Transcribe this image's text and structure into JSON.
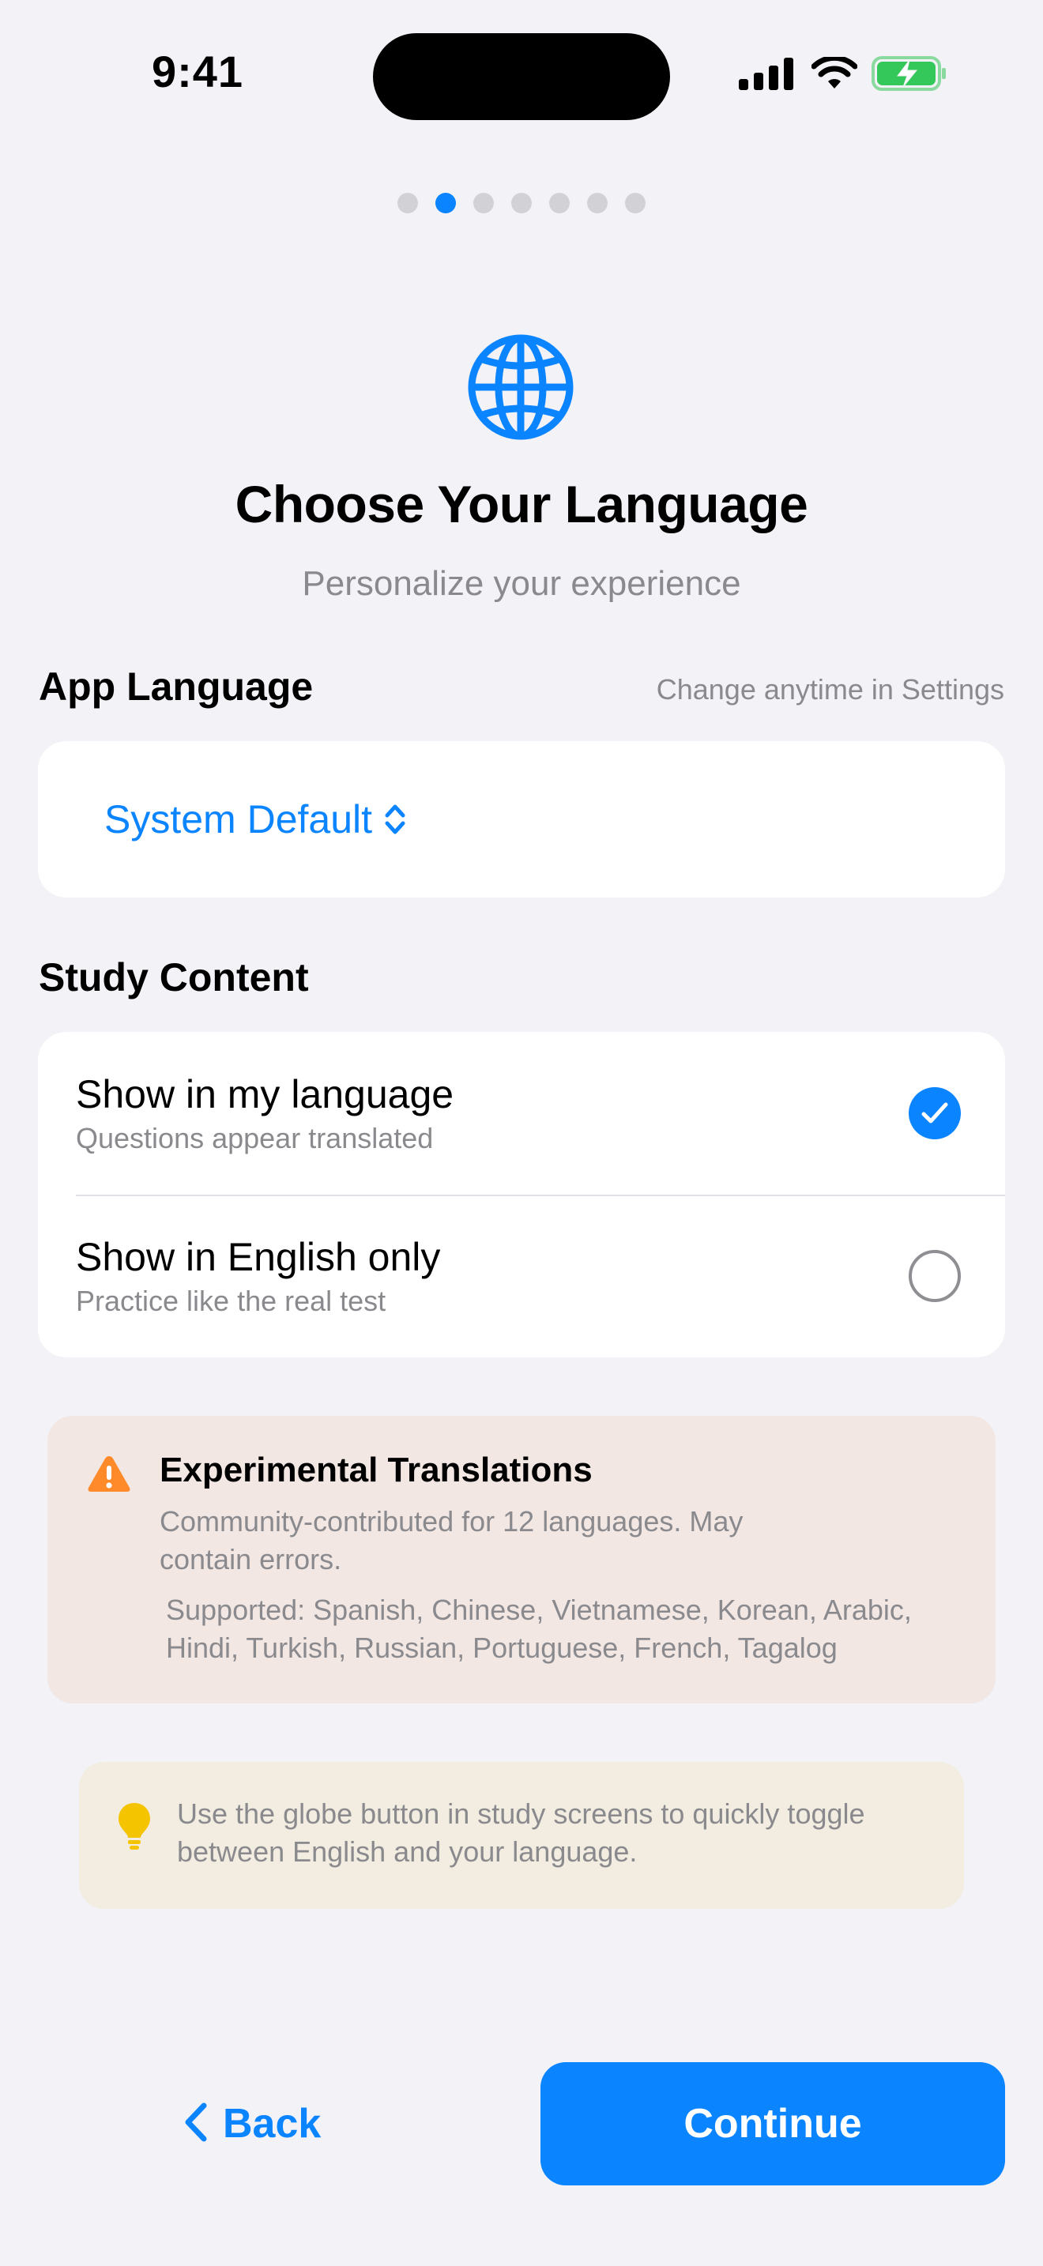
{
  "status_bar": {
    "time": "9:41",
    "icons": [
      "cellular-signal-icon",
      "wifi-icon",
      "battery-charging-icon"
    ]
  },
  "pager": {
    "total": 7,
    "current": 2
  },
  "header": {
    "icon": "globe-icon",
    "title": "Choose Your Language",
    "subtitle": "Personalize your experience"
  },
  "app_language": {
    "title": "App Language",
    "note": "Change anytime in Settings",
    "selected": "System Default"
  },
  "study_content": {
    "title": "Study Content",
    "options": [
      {
        "label": "Show in my language",
        "description": "Questions appear translated",
        "selected": true
      },
      {
        "label": "Show in English only",
        "description": "Practice like the real test",
        "selected": false
      }
    ]
  },
  "warning": {
    "icon": "warning-triangle-icon",
    "title": "Experimental Translations",
    "body": "Community-contributed for 12 languages. May contain errors.",
    "supported": "Supported: Spanish, Chinese, Vietnamese, Korean, Arabic, Hindi, Turkish, Russian, Portuguese, French, Tagalog"
  },
  "tip": {
    "icon": "lightbulb-icon",
    "text": "Use the globe button in study screens to quickly toggle between English and your language."
  },
  "footer": {
    "back_label": "Back",
    "continue_label": "Continue"
  },
  "colors": {
    "accent": "#0A84FF",
    "background": "#F2F2F7",
    "warning_orange": "#FF8A2A",
    "warning_bg": "#F2E7E3",
    "tip_yellow": "#F5C400",
    "tip_bg": "#F2EDE0",
    "battery_green": "#34C759"
  }
}
